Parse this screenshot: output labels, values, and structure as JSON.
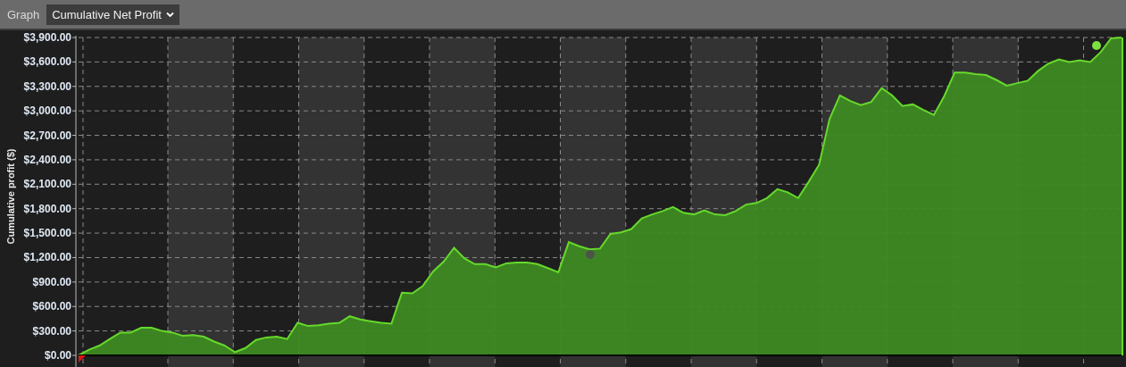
{
  "toolbar": {
    "label": "Graph",
    "select": {
      "value": "Cumulative Net Profit"
    }
  },
  "chart": {
    "chart_data": {
      "type": "area",
      "grid": true,
      "ylabel": "Cumulative profit ($)",
      "ylim": [
        0,
        3900
      ],
      "yticks": [
        {
          "value": 0,
          "label": "$0.00"
        },
        {
          "value": 300,
          "label": "$300.00"
        },
        {
          "value": 600,
          "label": "$600.00"
        },
        {
          "value": 900,
          "label": "$900.00"
        },
        {
          "value": 1200,
          "label": "$1,200.00"
        },
        {
          "value": 1500,
          "label": "$1,500.00"
        },
        {
          "value": 1800,
          "label": "$1,800.00"
        },
        {
          "value": 2100,
          "label": "$2,100.00"
        },
        {
          "value": 2400,
          "label": "$2,400.00"
        },
        {
          "value": 2700,
          "label": "$2,700.00"
        },
        {
          "value": 3000,
          "label": "$3,000.00"
        },
        {
          "value": 3300,
          "label": "$3,300.00"
        },
        {
          "value": 3600,
          "label": "$3,600.00"
        },
        {
          "value": 3900,
          "label": "$3,900.00"
        }
      ],
      "categories": [
        null,
        null,
        null,
        null,
        null,
        null,
        null,
        null,
        null,
        null,
        null,
        null,
        null,
        null,
        null,
        null,
        null,
        null,
        null,
        null,
        null,
        null,
        null,
        null,
        null,
        null,
        null,
        null,
        null,
        null,
        null,
        null,
        null,
        null,
        null,
        null,
        null,
        null,
        null,
        null,
        null,
        null,
        null,
        null,
        null,
        null,
        null,
        null,
        null,
        null,
        null,
        null,
        null,
        null,
        null,
        null,
        null,
        null,
        null,
        null,
        null,
        null,
        null,
        null,
        null,
        null,
        null,
        null,
        null,
        null,
        null,
        null,
        null,
        null,
        null,
        null,
        null,
        null,
        null,
        null,
        null,
        null,
        null,
        null,
        null,
        null,
        null,
        null,
        null,
        null,
        null,
        null,
        null,
        null,
        null,
        null,
        null,
        null,
        null,
        null,
        null
      ],
      "series": [
        {
          "color": "#66d92b",
          "values": [
            0,
            70,
            120,
            200,
            280,
            280,
            340,
            340,
            300,
            280,
            240,
            250,
            230,
            170,
            120,
            40,
            90,
            190,
            220,
            230,
            200,
            400,
            360,
            370,
            390,
            400,
            480,
            440,
            420,
            400,
            390,
            770,
            760,
            850,
            1030,
            1150,
            1320,
            1190,
            1120,
            1120,
            1080,
            1130,
            1140,
            1140,
            1120,
            1070,
            1020,
            1390,
            1340,
            1300,
            1310,
            1490,
            1510,
            1550,
            1680,
            1730,
            1770,
            1820,
            1750,
            1730,
            1780,
            1730,
            1720,
            1770,
            1850,
            1870,
            1930,
            2040,
            2000,
            1930,
            2130,
            2340,
            2900,
            3190,
            3120,
            3070,
            3110,
            3280,
            3190,
            3060,
            3080,
            3010,
            2950,
            3180,
            3470,
            3470,
            3450,
            3440,
            3380,
            3310,
            3340,
            3370,
            3490,
            3580,
            3630,
            3600,
            3620,
            3600,
            3720,
            3890,
            3900
          ]
        }
      ]
    }
  }
}
